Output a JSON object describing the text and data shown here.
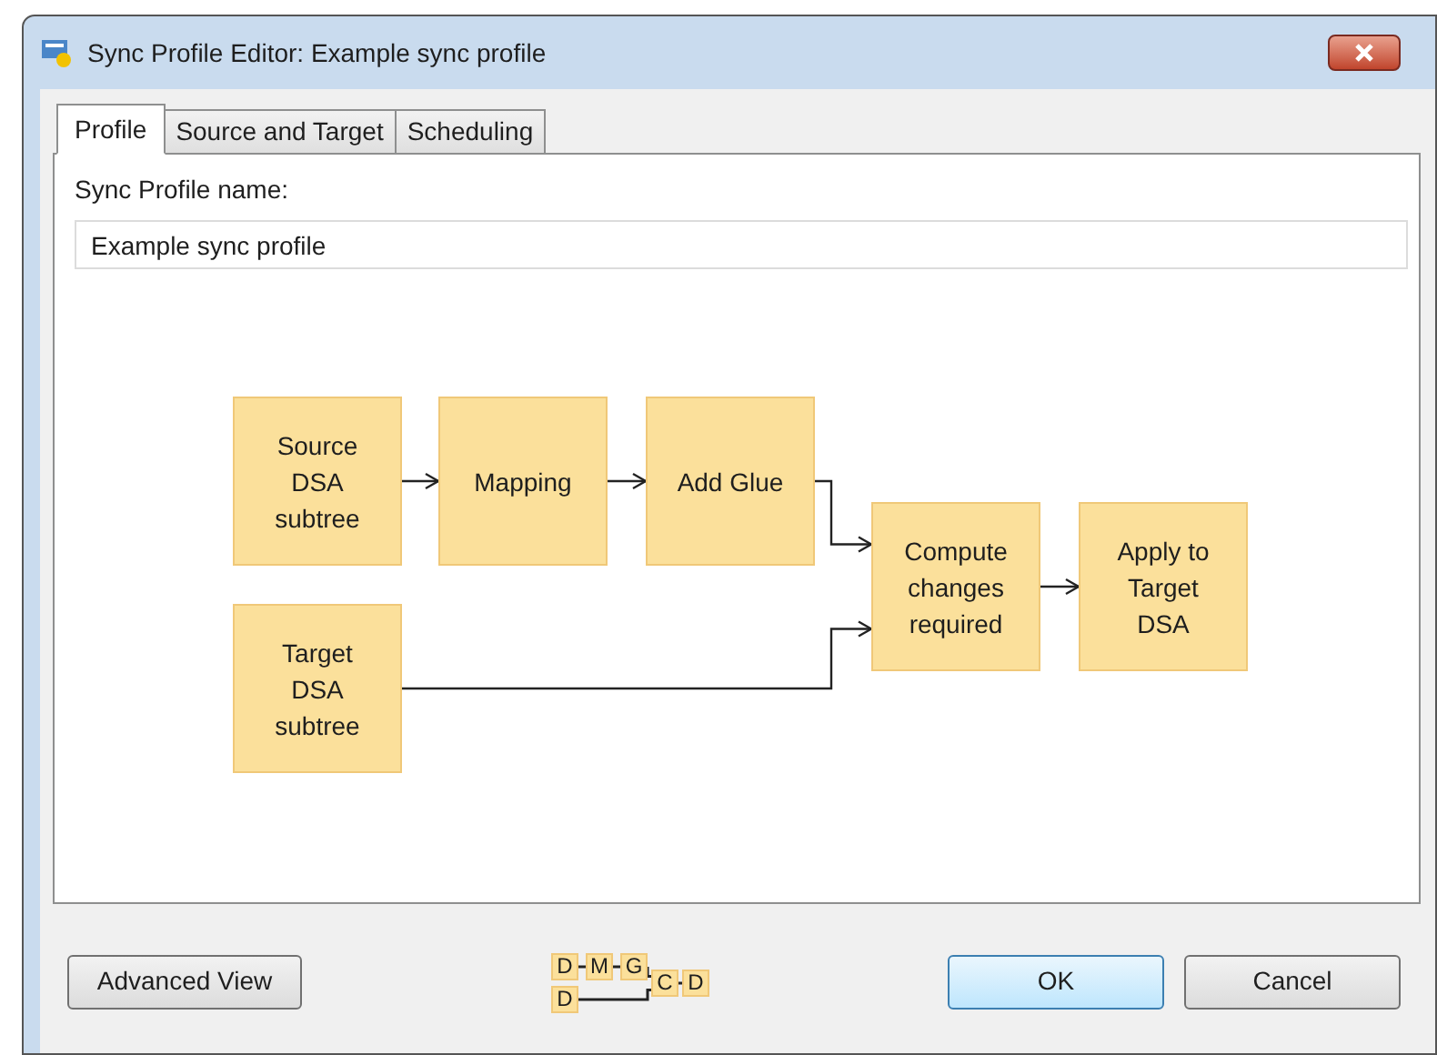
{
  "window": {
    "title": "Sync Profile Editor: Example sync profile"
  },
  "tabs": [
    {
      "label": "Profile",
      "selected": true
    },
    {
      "label": "Source and Target",
      "selected": false
    },
    {
      "label": "Scheduling",
      "selected": false
    }
  ],
  "profile_name": {
    "label": "Sync Profile name:",
    "value": "Example sync profile"
  },
  "diagram": {
    "nodes": [
      "Source DSA subtree",
      "Mapping",
      "Add Glue",
      "Target DSA subtree",
      "Compute changes required",
      "Apply to Target DSA"
    ]
  },
  "mini_diagram": {
    "nodes": [
      "D",
      "M",
      "G",
      "D",
      "C",
      "D"
    ]
  },
  "buttons": {
    "advanced": "Advanced View",
    "ok": "OK",
    "cancel": "Cancel"
  }
}
